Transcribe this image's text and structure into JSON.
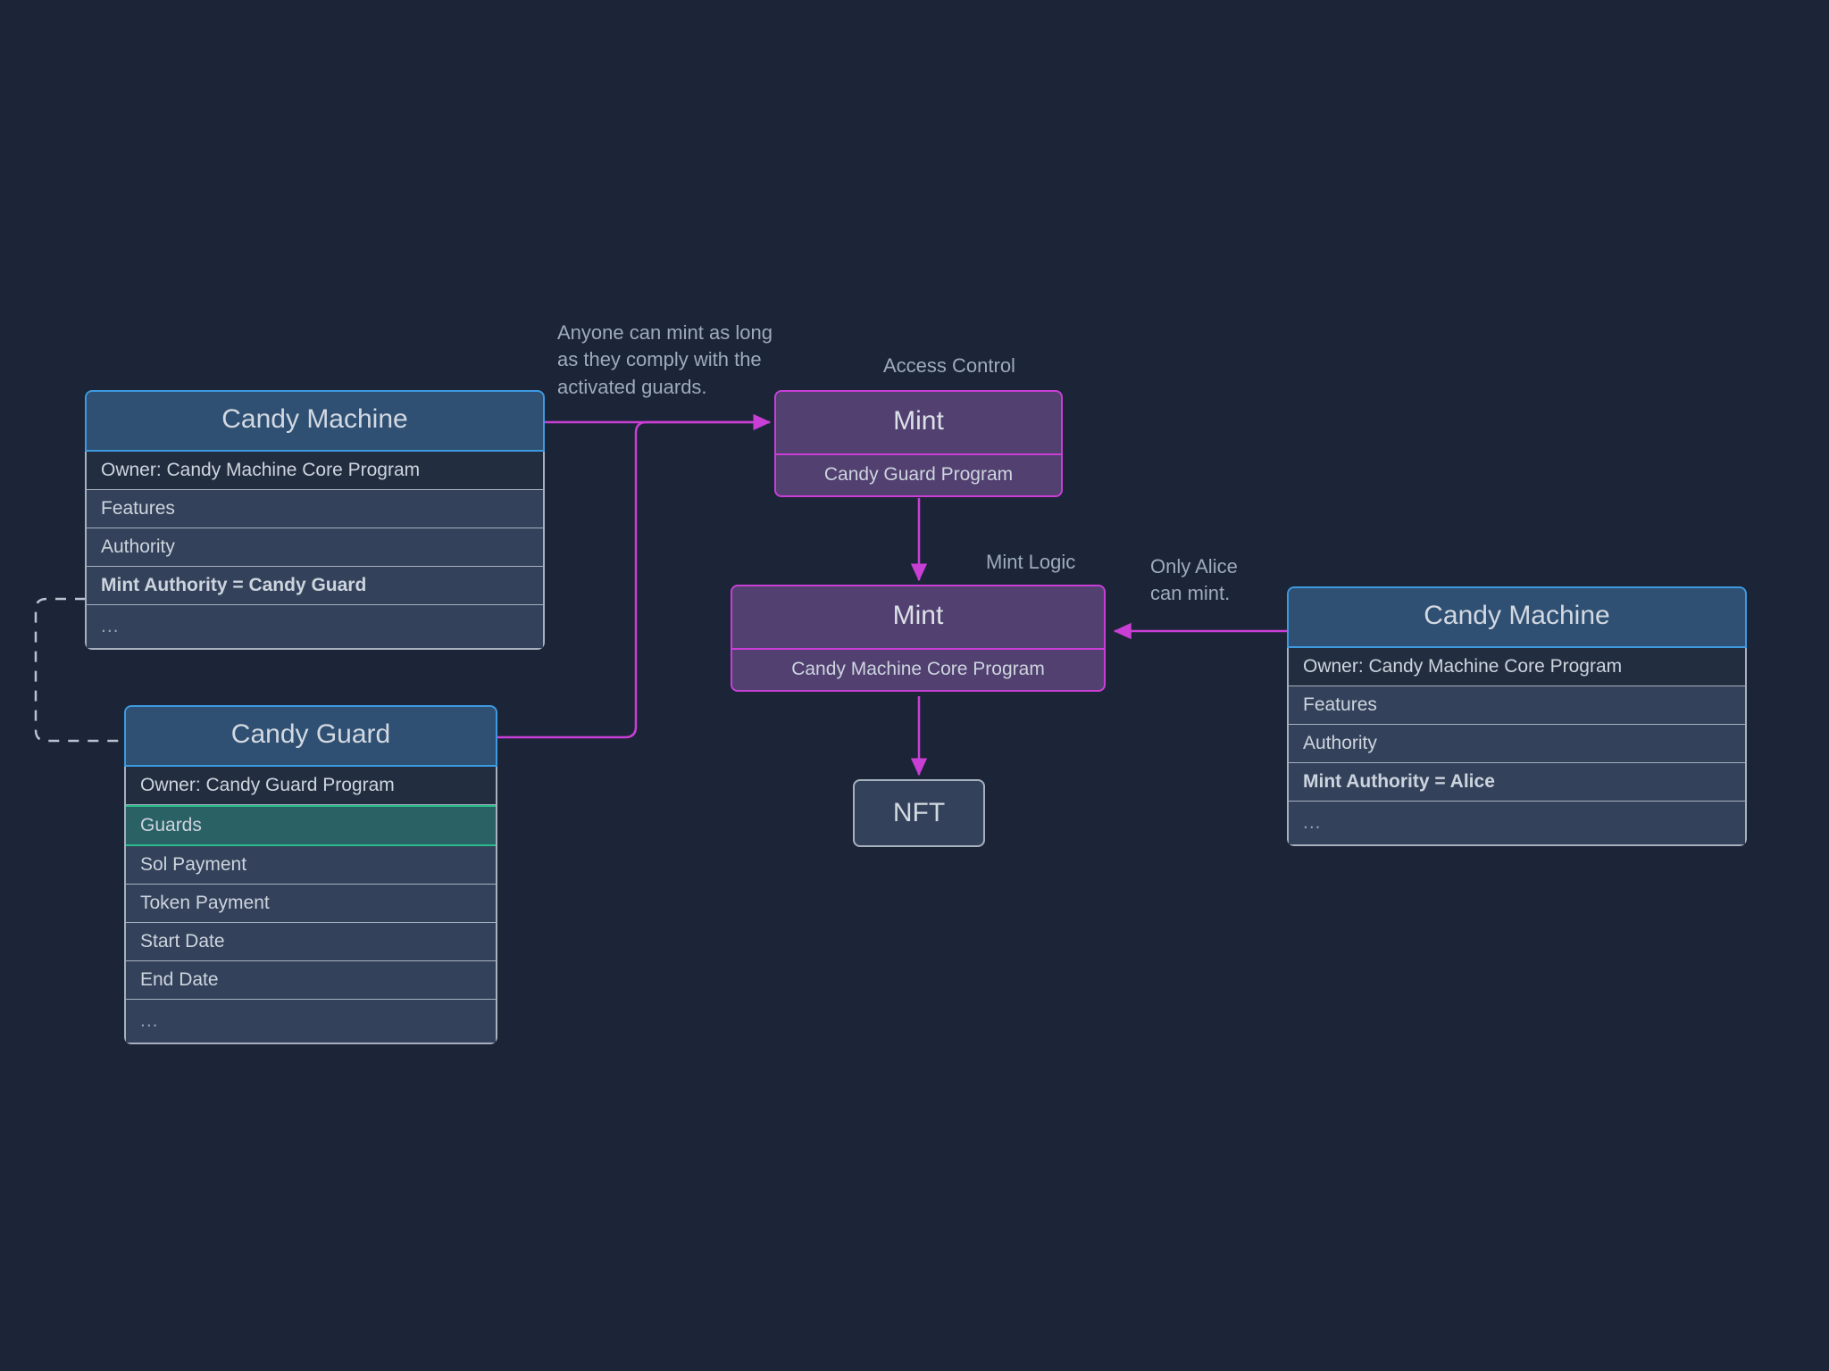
{
  "diagram": {
    "background_color": "#1c2537",
    "accent_magenta": "#c93fd6",
    "accent_blue": "#3d9ae0",
    "accent_teal": "#2bbc8a",
    "header_fill": "#2f5073",
    "row_fill": "#33425a",
    "purple_fill": "#514070"
  },
  "nodes": {
    "candy_machine_left": {
      "title": "Candy Machine",
      "rows": [
        "Owner: Candy Machine Core Program",
        "Features",
        "Authority",
        "Mint Authority = Candy Guard",
        "..."
      ]
    },
    "candy_guard": {
      "title": "Candy Guard",
      "rows": [
        "Owner: Candy Guard Program",
        "Guards",
        "Sol Payment",
        "Token Payment",
        "Start Date",
        "End Date",
        "..."
      ]
    },
    "mint_top": {
      "title": "Mint",
      "subtitle": "Candy Guard Program"
    },
    "mint_bottom": {
      "title": "Mint",
      "subtitle": "Candy Machine Core Program"
    },
    "nft": {
      "title": "NFT"
    },
    "candy_machine_right": {
      "title": "Candy Machine",
      "rows": [
        "Owner: Candy Machine Core Program",
        "Features",
        "Authority",
        "Mint Authority = Alice",
        "..."
      ]
    }
  },
  "edge_labels": {
    "anyone_can_mint": "Anyone can mint as long\nas they comply with the\nactivated guards.",
    "access_control": "Access Control",
    "mint_logic": "Mint Logic",
    "only_alice": "Only Alice\ncan mint."
  }
}
